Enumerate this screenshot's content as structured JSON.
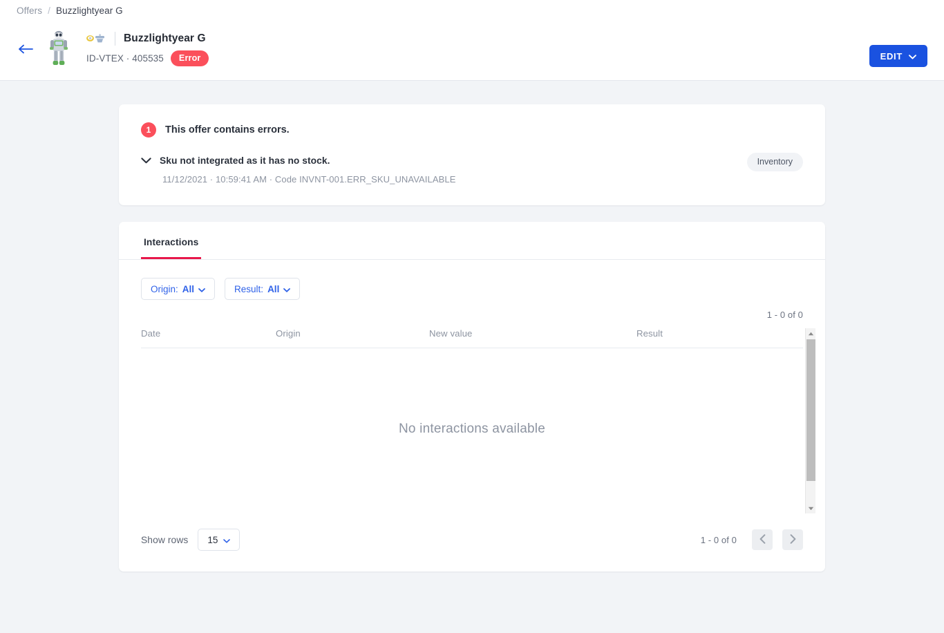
{
  "breadcrumb": {
    "root": "Offers",
    "separator": "/",
    "current": "Buzzlightyear G"
  },
  "header": {
    "back_icon": "arrow-left-icon",
    "thumbnail_alt": "buzz-lightyear-product-image",
    "marketplace_logo": "marketplace-logo-icon",
    "title": "Buzzlightyear G",
    "offer_id": "ID-VTEX · 405535",
    "status_label": "Error",
    "status_color": "#fb4f5b",
    "edit_label": "EDIT",
    "edit_chevron": "chevron-down-icon",
    "edit_color": "#1a52e0"
  },
  "errors_card": {
    "count": "1",
    "summary": "This offer contains errors.",
    "item": {
      "toggle_icon": "chevron-down-icon",
      "title": "Sku not integrated as it has no stock.",
      "date": "11/12/2021",
      "time": "10:59:41 AM",
      "code_label": "Code",
      "code_value": "INVNT-001.ERR_SKU_UNAVAILABLE",
      "meta_full": "11/12/2021 · 10:59:41 AM · Code INVNT-001.ERR_SKU_UNAVAILABLE",
      "tag": "Inventory"
    }
  },
  "interactions": {
    "tab_label": "Interactions",
    "tab_accent": "#e8174a",
    "filters": [
      {
        "prefix": "Origin:",
        "value": "All",
        "icon": "chevron-down-icon"
      },
      {
        "prefix": "Result:",
        "value": "All",
        "icon": "chevron-down-icon"
      }
    ],
    "count_top": "1 - 0 of 0",
    "columns": [
      "Date",
      "Origin",
      "New value",
      "Result"
    ],
    "rows": [],
    "empty_message": "No interactions available",
    "footer": {
      "show_rows_label": "Show rows",
      "rows_value": "15",
      "rows_icon": "chevron-down-icon",
      "count": "1 - 0 of 0",
      "prev_icon": "chevron-left-icon",
      "next_icon": "chevron-right-icon"
    },
    "scrollbar": {
      "up_icon": "caret-up-icon",
      "down_icon": "caret-down-icon"
    }
  }
}
